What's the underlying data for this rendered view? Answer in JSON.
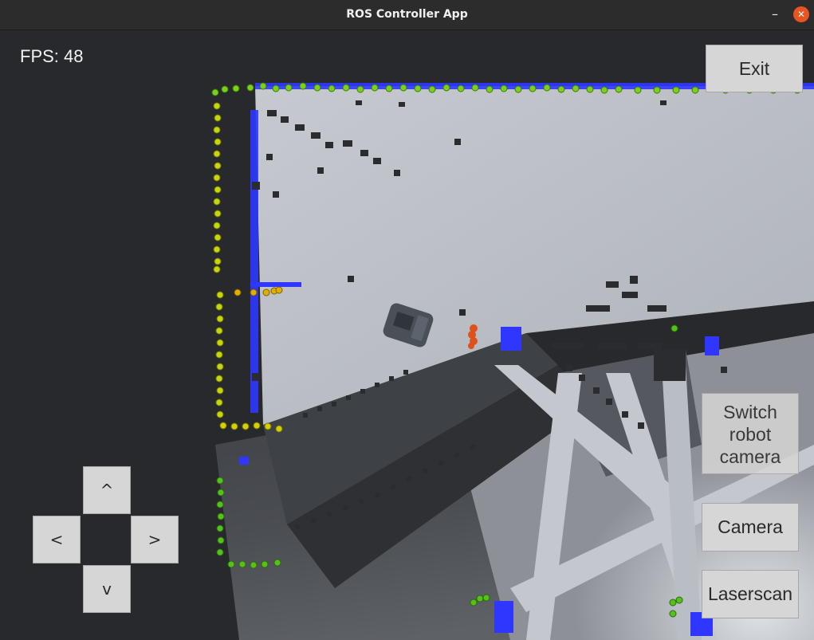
{
  "window": {
    "title": "ROS Controller App",
    "minimize_glyph": "–",
    "close_glyph": "✕"
  },
  "hud": {
    "fps": "FPS: 48"
  },
  "buttons": {
    "exit": "Exit",
    "switch_camera": "Switch robot camera",
    "camera": "Camera",
    "laserscan": "Laserscan"
  },
  "dpad": {
    "up": "^",
    "left": "<",
    "right": ">",
    "down": "v"
  },
  "colors": {
    "laser_near": "#3fbf1a",
    "laser_mid": "#d6d000",
    "laser_far": "#e0a000",
    "obstacle_hit": "#e0501a",
    "map_free": "#b8bcc4",
    "map_occupied": "#2a2c30",
    "map_border": "#2f37ff"
  }
}
